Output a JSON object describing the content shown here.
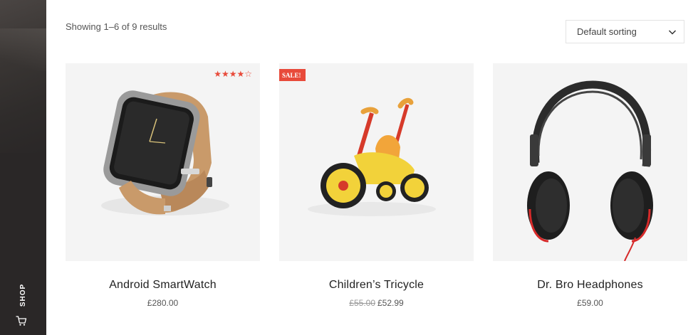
{
  "sidebar": {
    "shop_label": "SHOP",
    "cart_icon": "cart-icon"
  },
  "toolbar": {
    "result_count": "Showing 1–6 of 9 results",
    "sort_value": "Default sorting",
    "sort_icon": "chevron-down-icon"
  },
  "colors": {
    "sidebar_bg": "#2a2727",
    "accent": "#e84a3a",
    "card_bg": "#f4f4f4"
  },
  "products": [
    {
      "name": "Android SmartWatch",
      "price": "£280.00",
      "rating": 4,
      "rating_max": 5,
      "rating_stars": "★★★★☆"
    },
    {
      "name": "Children’s Tricycle",
      "badge": "SALE!",
      "price_old": "£55.00",
      "price": "£52.99"
    },
    {
      "name": "Dr. Bro Headphones",
      "price": "£59.00"
    }
  ]
}
